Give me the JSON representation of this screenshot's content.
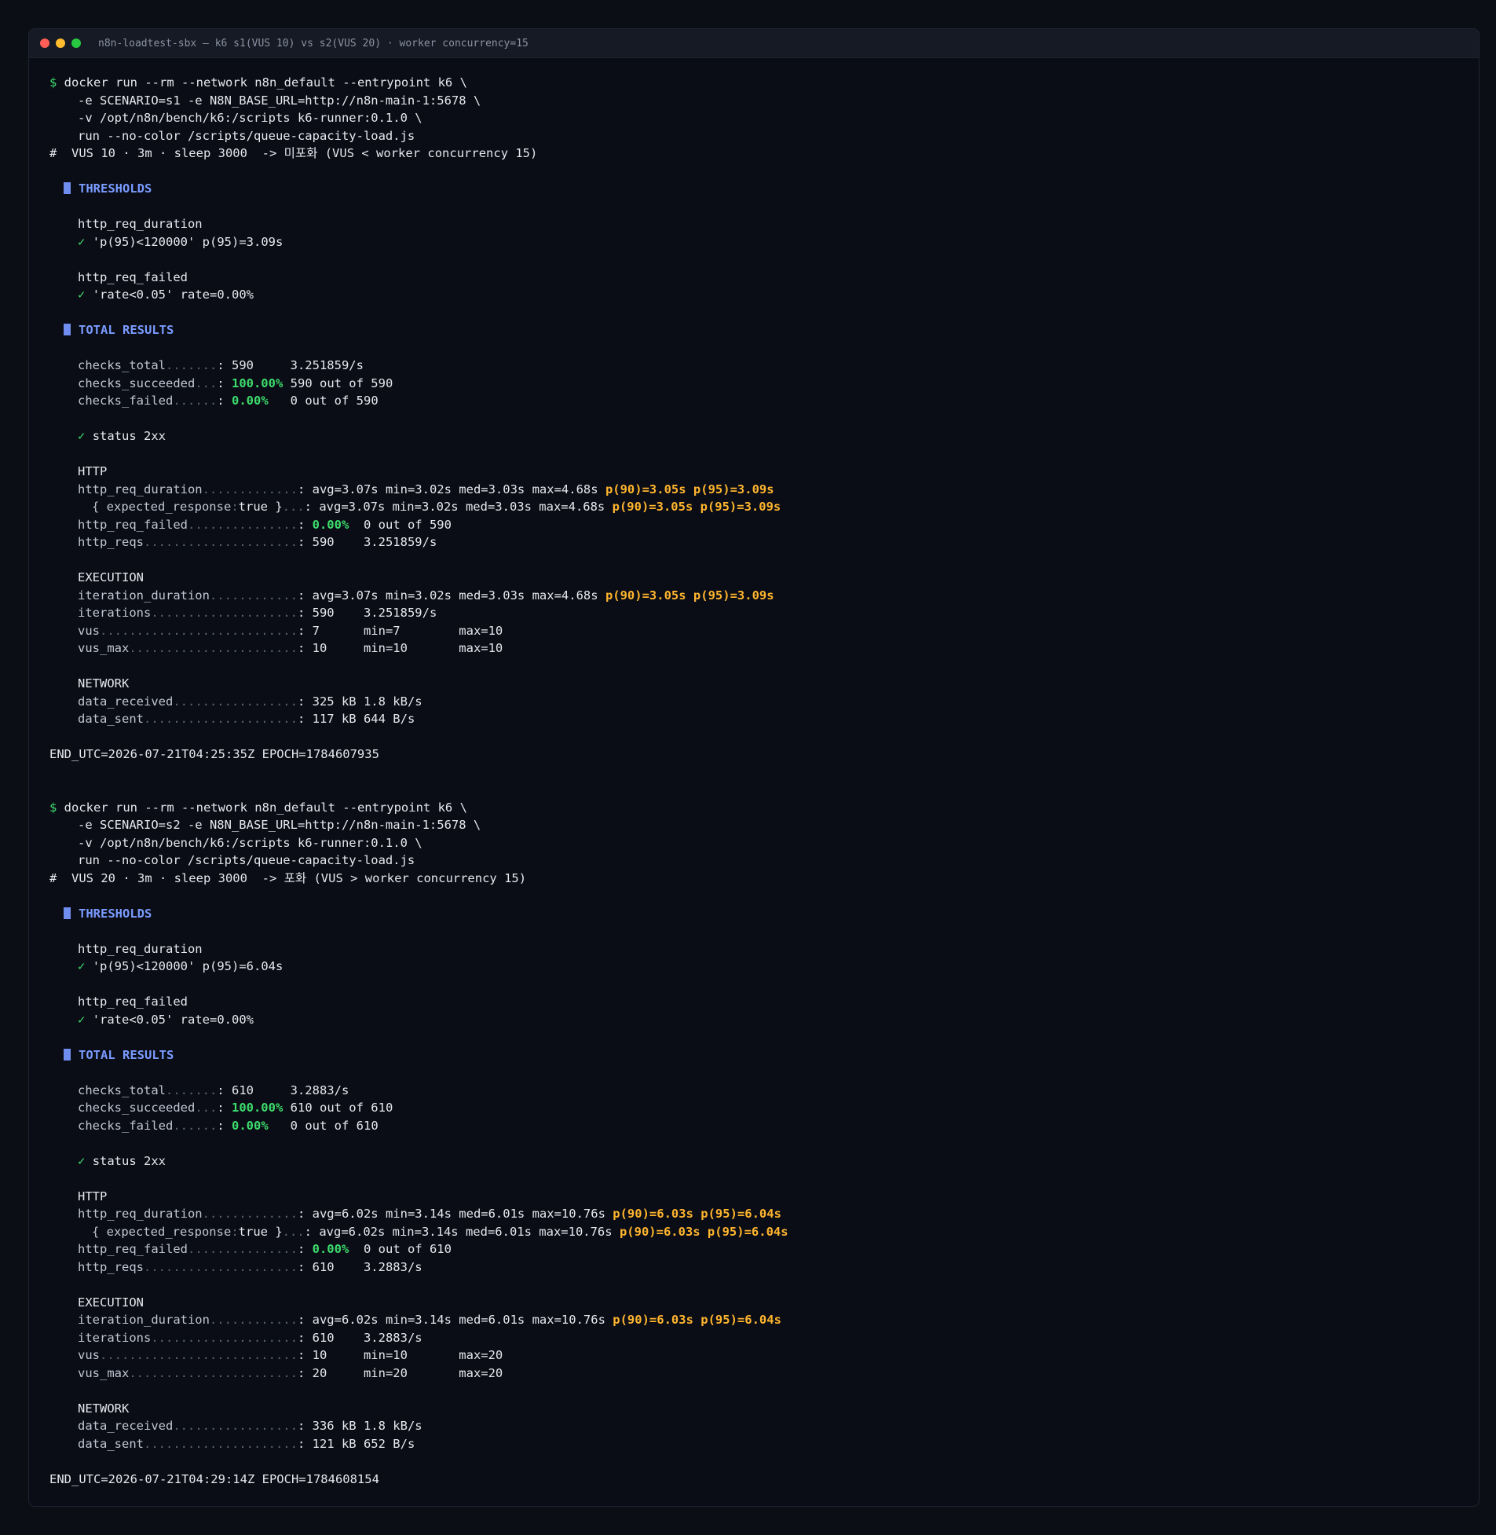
{
  "window": {
    "title": "n8n-loadtest-sbx — k6 s1(VUS 10) vs s2(VUS 20) · worker concurrency=15"
  },
  "runs": [
    {
      "cmd": [
        "docker run --rm --network n8n_default --entrypoint k6 \\",
        "-e SCENARIO=s1 -e N8N_BASE_URL=http://n8n-main-1:5678 \\",
        "-v /opt/n8n/bench/k6:/scripts k6-runner:0.1.0 \\",
        "run --no-color /scripts/queue-capacity-load.js"
      ],
      "comment": "#  VUS 10 · 3m · sleep 3000  -> 미포화 (VUS < worker concurrency 15)",
      "thresholds_title": "THRESHOLDS",
      "thr1_name": "http_req_duration",
      "thr1_check": "✓",
      "thr1_val": "'p(95)<120000' p(95)=3.09s",
      "thr2_name": "http_req_failed",
      "thr2_check": "✓",
      "thr2_val": "'rate<0.05' rate=0.00%",
      "total_title": "TOTAL RESULTS",
      "ct_key": "checks_total",
      "ct_dots": ".......",
      "ct_val": "590     3.251859/s",
      "cs_key": "checks_succeeded",
      "cs_dots": "...",
      "cs_pct": "100.00%",
      "cs_rest": "590 out of 590",
      "cf_key": "checks_failed",
      "cf_dots": "......",
      "cf_pct": "0.00%",
      "cf_rest": "  0 out of 590",
      "status_check": "✓",
      "status_text": "status 2xx",
      "http_title": "HTTP",
      "hrd_key": "http_req_duration",
      "hrd_dots": ".............",
      "hrd_val": "avg=3.07s min=3.02s med=3.03s max=4.68s",
      "hrd_p": "p(90)=3.05s p(95)=3.09s",
      "exp_key_a": "{ expected_response",
      "exp_key_b": ":",
      "exp_key_c": "true }",
      "exp_dots": "...",
      "exp_val": "avg=3.07s min=3.02s med=3.03s max=4.68s",
      "exp_p": "p(90)=3.05s p(95)=3.09s",
      "hrf_key": "http_req_failed",
      "hrf_dots": "...............",
      "hrf_pct": "0.00%",
      "hrf_rest": " 0 out of 590",
      "hr_key": "http_reqs",
      "hr_dots": ".....................",
      "hr_val": "590    3.251859/s",
      "exec_title": "EXECUTION",
      "id_key": "iteration_duration",
      "id_dots": "............",
      "id_val": "avg=3.07s min=3.02s med=3.03s max=4.68s",
      "id_p": "p(90)=3.05s p(95)=3.09s",
      "it_key": "iterations",
      "it_dots": "....................",
      "it_val": "590    3.251859/s",
      "vus_key": "vus",
      "vus_dots": "...........................",
      "vus_val": "7      min=7        max=10",
      "vm_key": "vus_max",
      "vm_dots": ".......................",
      "vm_val": "10     min=10       max=10",
      "net_title": "NETWORK",
      "dr_key": "data_received",
      "dr_dots": ".................",
      "dr_val": "325 kB 1.8 kB/s",
      "ds_key": "data_sent",
      "ds_dots": ".....................",
      "ds_val": "117 kB 644 B/s",
      "end": "END_UTC=2026-07-21T04:25:35Z EPOCH=1784607935"
    },
    {
      "cmd": [
        "docker run --rm --network n8n_default --entrypoint k6 \\",
        "-e SCENARIO=s2 -e N8N_BASE_URL=http://n8n-main-1:5678 \\",
        "-v /opt/n8n/bench/k6:/scripts k6-runner:0.1.0 \\",
        "run --no-color /scripts/queue-capacity-load.js"
      ],
      "comment": "#  VUS 20 · 3m · sleep 3000  -> 포화 (VUS > worker concurrency 15)",
      "thresholds_title": "THRESHOLDS",
      "thr1_name": "http_req_duration",
      "thr1_check": "✓",
      "thr1_val": "'p(95)<120000' p(95)=6.04s",
      "thr2_name": "http_req_failed",
      "thr2_check": "✓",
      "thr2_val": "'rate<0.05' rate=0.00%",
      "total_title": "TOTAL RESULTS",
      "ct_key": "checks_total",
      "ct_dots": ".......",
      "ct_val": "610     3.2883/s",
      "cs_key": "checks_succeeded",
      "cs_dots": "...",
      "cs_pct": "100.00%",
      "cs_rest": "610 out of 610",
      "cf_key": "checks_failed",
      "cf_dots": "......",
      "cf_pct": "0.00%",
      "cf_rest": "  0 out of 610",
      "status_check": "✓",
      "status_text": "status 2xx",
      "http_title": "HTTP",
      "hrd_key": "http_req_duration",
      "hrd_dots": ".............",
      "hrd_val": "avg=6.02s min=3.14s med=6.01s max=10.76s",
      "hrd_p": "p(90)=6.03s p(95)=6.04s",
      "exp_key_a": "{ expected_response",
      "exp_key_b": ":",
      "exp_key_c": "true }",
      "exp_dots": "...",
      "exp_val": "avg=6.02s min=3.14s med=6.01s max=10.76s",
      "exp_p": "p(90)=6.03s p(95)=6.04s",
      "hrf_key": "http_req_failed",
      "hrf_dots": "...............",
      "hrf_pct": "0.00%",
      "hrf_rest": " 0 out of 610",
      "hr_key": "http_reqs",
      "hr_dots": ".....................",
      "hr_val": "610    3.2883/s",
      "exec_title": "EXECUTION",
      "id_key": "iteration_duration",
      "id_dots": "............",
      "id_val": "avg=6.02s min=3.14s med=6.01s max=10.76s",
      "id_p": "p(90)=6.03s p(95)=6.04s",
      "it_key": "iterations",
      "it_dots": "....................",
      "it_val": "610    3.2883/s",
      "vus_key": "vus",
      "vus_dots": "...........................",
      "vus_val": "10     min=10       max=20",
      "vm_key": "vus_max",
      "vm_dots": ".......................",
      "vm_val": "20     min=20       max=20",
      "net_title": "NETWORK",
      "dr_key": "data_received",
      "dr_dots": ".................",
      "dr_val": "336 kB 1.8 kB/s",
      "ds_key": "data_sent",
      "ds_dots": ".....................",
      "ds_val": "121 kB 652 B/s",
      "end": "END_UTC=2026-07-21T04:29:14Z EPOCH=1784608154"
    }
  ],
  "colors": {
    "accent": "#7a9bff",
    "ok": "#3ddc6c",
    "highlight": "#ffb52e",
    "background": "#0a0d16"
  }
}
